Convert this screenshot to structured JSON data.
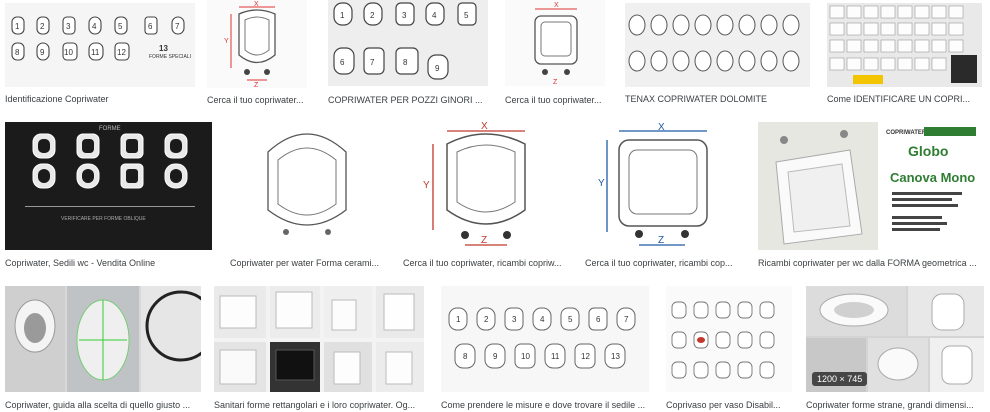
{
  "results": [
    {
      "caption": "Identificazione Copriwater",
      "style": "numbered-grid-white",
      "labels": [
        "1",
        "2",
        "3",
        "4",
        "5",
        "6",
        "7",
        "8",
        "9",
        "10",
        "11",
        "12",
        "13"
      ],
      "extra": "FORME SPECIALI"
    },
    {
      "caption": "Cerca il tuo copriwater...",
      "style": "diagram-xyz"
    },
    {
      "caption": "COPRIWATER PER POZZI GINORI ...",
      "style": "numbered-grid-large",
      "labels": [
        "1",
        "2",
        "3",
        "4",
        "5",
        "6",
        "7",
        "8",
        "9"
      ]
    },
    {
      "caption": "Cerca il tuo copriwater...",
      "style": "diagram-square"
    },
    {
      "caption": "TENAX COPRIWATER DOLOMITE",
      "style": "shapes-grid"
    },
    {
      "caption": "Come IDENTIFICARE UN COPRI...",
      "style": "product-collage"
    },
    {
      "caption": "Copriwater, Sedili wc - Vendita Online",
      "style": "dark-grid",
      "heading": "FORME",
      "footer": "VERIFICARE PER FORME OBLIQUE"
    },
    {
      "caption": "Copriwater per water Forma cerami...",
      "style": "outline-seat"
    },
    {
      "caption": "Cerca il tuo copriwater, ricambi copriw...",
      "style": "diagram-xyz-color"
    },
    {
      "caption": "Cerca il tuo copriwater, ricambi cop...",
      "style": "diagram-square-color"
    },
    {
      "caption": "Ricambi copriwater per wc dalla FORMA geometrica ...",
      "style": "product-card",
      "brand": "Globo",
      "model": "Canova Mono",
      "tag": "COPRIWATER"
    },
    {
      "caption": "Copriwater, guida alla scelta di quello giusto ...",
      "style": "photo-guide"
    },
    {
      "caption": "Sanitari forme rettangolari e i loro copriwater. Og...",
      "style": "photo-sanitari"
    },
    {
      "caption": "Come prendere le misure e dove trovare il sedile ...",
      "style": "numbered-grid-light",
      "labels": [
        "1",
        "2",
        "3",
        "4",
        "5",
        "6",
        "7",
        "8",
        "9",
        "10",
        "11",
        "12",
        "13"
      ]
    },
    {
      "caption": "Coprivaso per vaso Disabil...",
      "style": "disabled-grid"
    },
    {
      "caption": "Copriwater forme strane, grandi dimensi...",
      "style": "photo-collage",
      "badge": "1200 × 745"
    }
  ]
}
